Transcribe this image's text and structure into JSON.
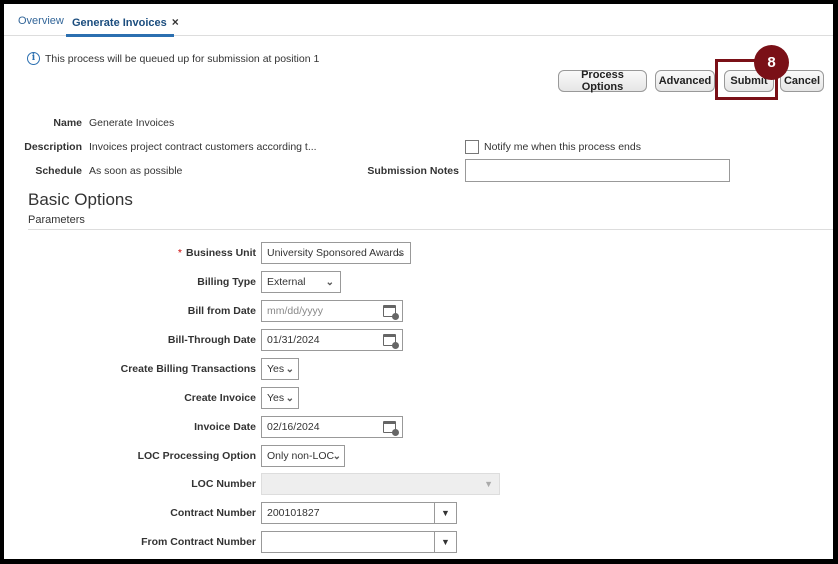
{
  "tabs": [
    {
      "label": "Overview"
    },
    {
      "label": "Generate Invoices",
      "close": "×"
    }
  ],
  "info": {
    "icon": "info-icon",
    "text": "This process will be queued up for submission at position 1"
  },
  "buttons": {
    "process_options": "Process Options",
    "advanced": "Advanced",
    "submit": "Submit",
    "cancel": "Cancel"
  },
  "step_badge": "8",
  "header_fields": {
    "name_label": "Name",
    "name_value": "Generate Invoices",
    "description_label": "Description",
    "description_value": "Invoices project contract customers according t...",
    "schedule_label": "Schedule",
    "schedule_value": "As soon as possible",
    "notify_label": "Notify me when this process ends",
    "submission_notes_label": "Submission Notes"
  },
  "section": {
    "title": "Basic Options",
    "subtitle": "Parameters"
  },
  "params": {
    "required_mark": "*",
    "business_unit_label": "Business Unit",
    "business_unit_value": "University Sponsored Awards",
    "billing_type_label": "Billing Type",
    "billing_type_value": "External",
    "bill_from_date_label": "Bill from Date",
    "bill_from_date_placeholder": "mm/dd/yyyy",
    "bill_through_date_label": "Bill-Through Date",
    "bill_through_date_value": "01/31/2024",
    "create_billing_transactions_label": "Create Billing Transactions",
    "create_billing_transactions_value": "Yes",
    "create_invoice_label": "Create Invoice",
    "create_invoice_value": "Yes",
    "invoice_date_label": "Invoice Date",
    "invoice_date_value": "02/16/2024",
    "loc_processing_option_label": "LOC Processing Option",
    "loc_processing_option_value": "Only non-LOC",
    "loc_number_label": "LOC Number",
    "contract_number_label": "Contract Number",
    "contract_number_value": "200101827",
    "from_contract_number_label": "From Contract Number"
  },
  "colors": {
    "highlight": "#7a1017",
    "link": "#336699",
    "tab_underline": "#2b6fb0"
  }
}
